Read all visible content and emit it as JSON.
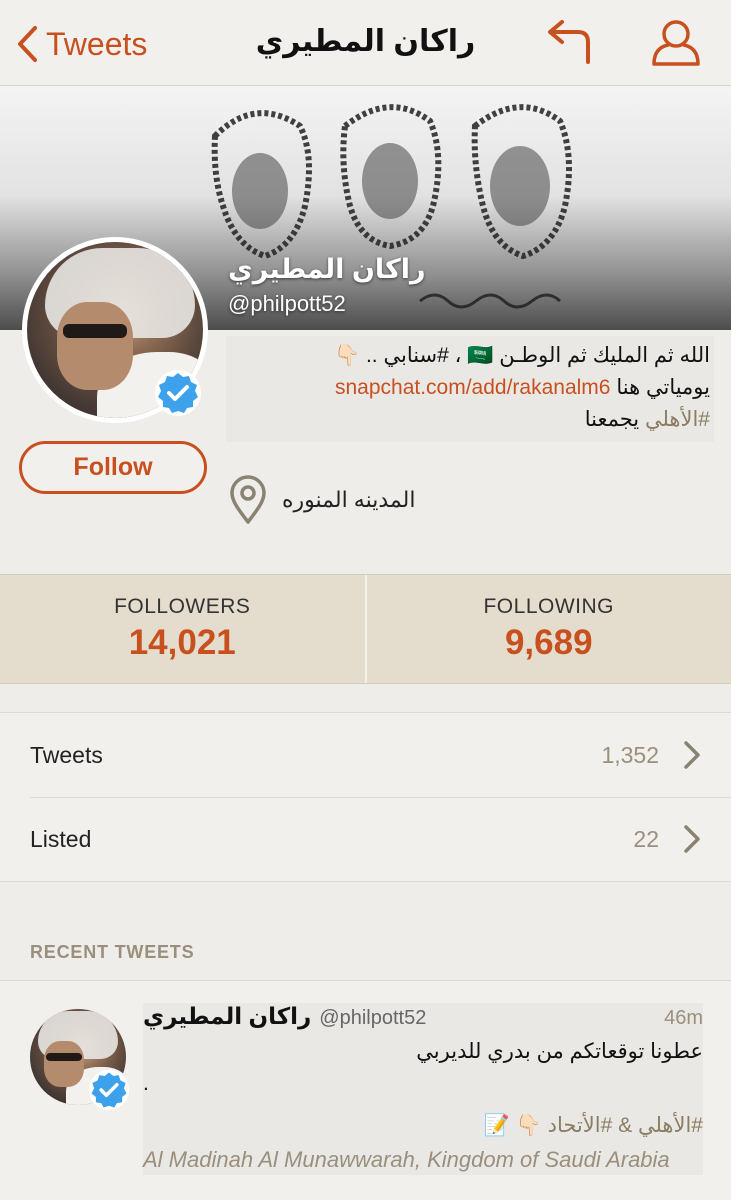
{
  "nav": {
    "back_label": "Tweets",
    "title": "راكان المطيري",
    "reply_icon": "reply-icon",
    "profile_icon": "person-icon"
  },
  "profile": {
    "name": "راكان المطيري",
    "handle": "@philpott52",
    "follow_label": "Follow",
    "bio": {
      "line1": "الله ثم المليك ثم الوطـن 🇸🇦 ، #سنابي .. 👇🏻",
      "line2_text": "يومياتي هنا",
      "line2_link": "snapchat.com/add/rakanalm6",
      "line3_tag": "#الأهلي",
      "line3_text": "يجمعنا"
    },
    "location": "المدينه المنوره",
    "location_icon": "location-pin-icon",
    "verified_icon": "verified-badge-icon"
  },
  "stats": {
    "followers_label": "FOLLOWERS",
    "followers_value": "14,021",
    "following_label": "FOLLOWING",
    "following_value": "9,689"
  },
  "rows": [
    {
      "label": "Tweets",
      "count": "1,352"
    },
    {
      "label": "Listed",
      "count": "22"
    }
  ],
  "recent": {
    "section_title": "RECENT TWEETS",
    "tweet": {
      "name": "راكان المطيري",
      "handle": "@philpott52",
      "time": "46m",
      "text": "عطونا توقعاتكم من بدري للديربي",
      "dot": ".",
      "tags": "#الأهلي & #الأتحاد 👇🏻 📝",
      "location": "Al Madinah Al Munawwarah, Kingdom of Saudi Arabia"
    }
  },
  "colors": {
    "accent": "#c8501f",
    "stats_bg": "#e4ddcd",
    "muted": "#9a8f7c",
    "verified": "#3ea1ec"
  }
}
